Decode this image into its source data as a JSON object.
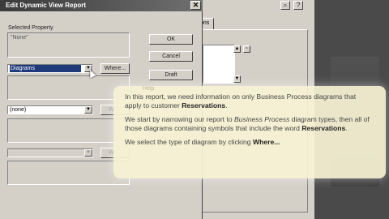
{
  "dialog": {
    "title": "Edit Dynamic View Report",
    "close_glyph": "✕",
    "selected_property_label": "Selected Property",
    "selected_property_value": "\"None\"",
    "buttons": {
      "ok": "OK",
      "cancel": "Cancel",
      "draft": "Draft"
    },
    "rows": [
      {
        "value": "Diagrams",
        "button": "Where..."
      },
      {
        "value": "(none)",
        "button": "Wh..."
      },
      {
        "value": "",
        "button": "Wh..."
      }
    ]
  },
  "background": {
    "tab_label": "ons",
    "hidden_button_text": "Help"
  },
  "tooltip": {
    "p1_a": "In this report, we need information on only Business Process diagrams that apply to customer ",
    "p1_b": "Reservations",
    "p1_c": ".",
    "p2_a": "We start by narrowing our report to ",
    "p2_b": "Business Process",
    "p2_c": " diagram types, then all of those diagrams containing symbols that include the word ",
    "p2_d": "Reservations",
    "p2_e": ".",
    "p3_a": "We select the type of diagram by clicking ",
    "p3_b": "Where...",
    "p3_c": ""
  }
}
